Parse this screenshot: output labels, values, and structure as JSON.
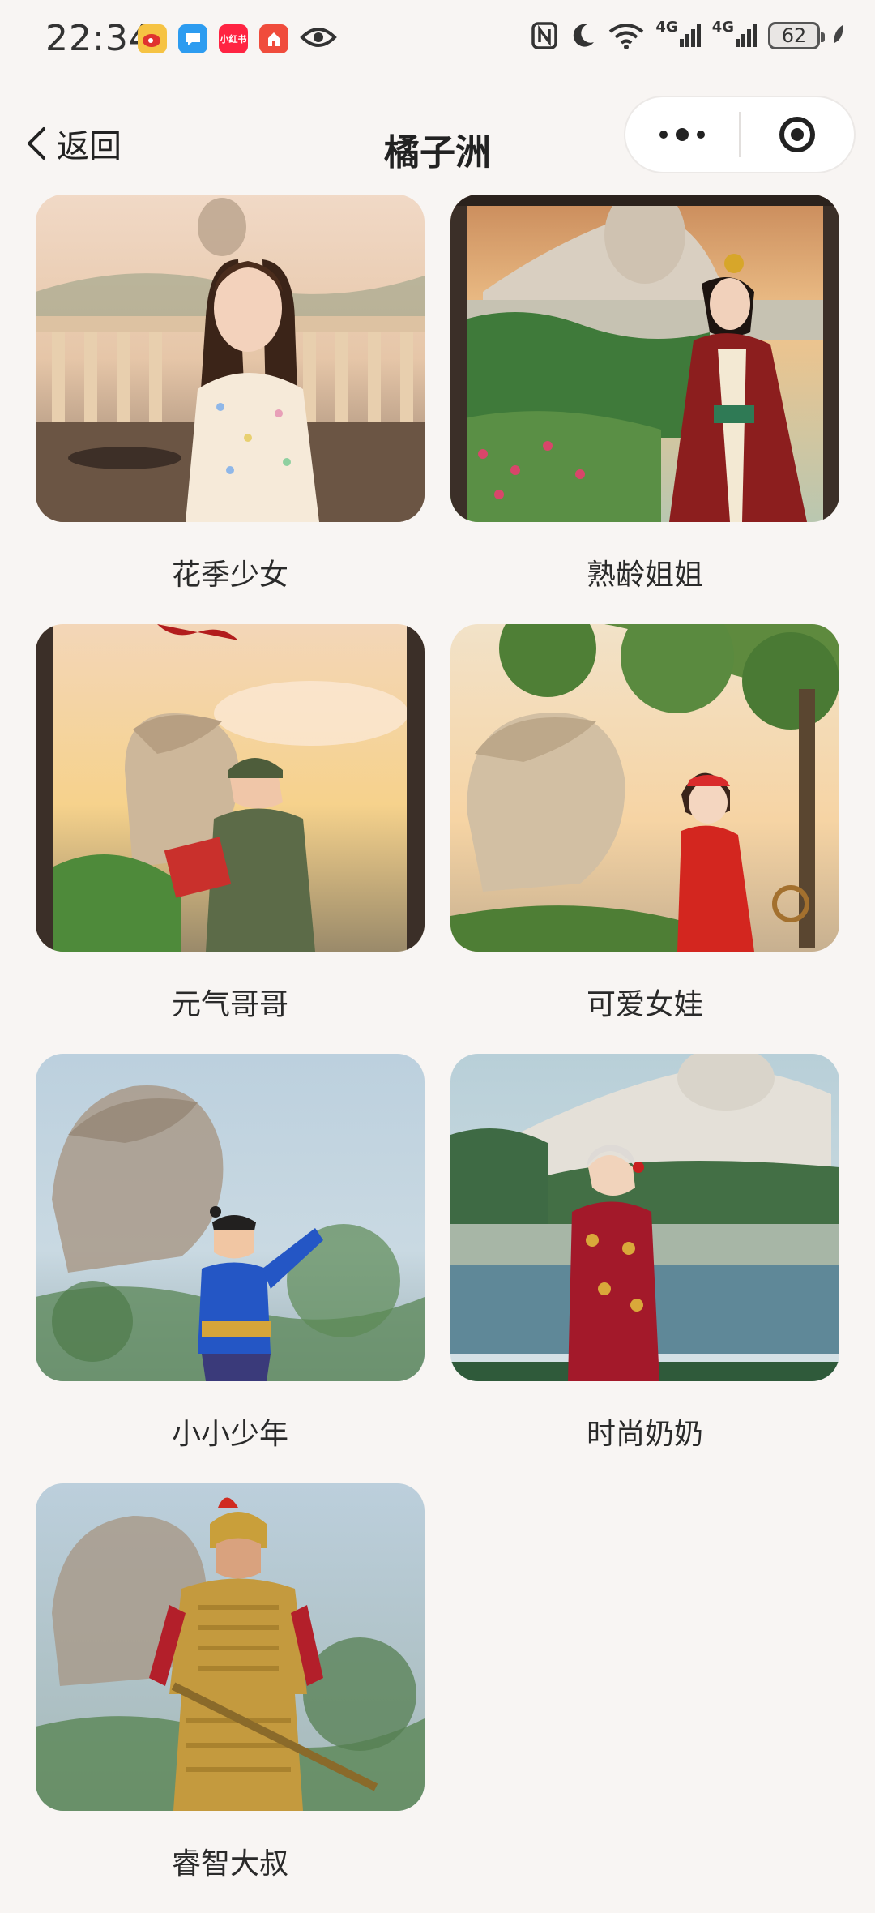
{
  "status_bar": {
    "time": "22:34",
    "battery": "62",
    "network_1": "4G",
    "network_2": "4G",
    "app_icons": [
      "weibo-icon",
      "message-icon",
      "xiaohongshu-icon",
      "app-icon",
      "eye-icon"
    ],
    "xiaohongshu_text": "小红书"
  },
  "nav": {
    "back_label": "返回",
    "title": "橘子洲"
  },
  "items": [
    {
      "label": "花季少女"
    },
    {
      "label": "熟龄姐姐"
    },
    {
      "label": "元气哥哥"
    },
    {
      "label": "可爱女娃"
    },
    {
      "label": "小小少年"
    },
    {
      "label": "时尚奶奶"
    },
    {
      "label": "睿智大叔"
    }
  ],
  "colors": {
    "background": "#f8f5f3",
    "text": "#222222"
  }
}
